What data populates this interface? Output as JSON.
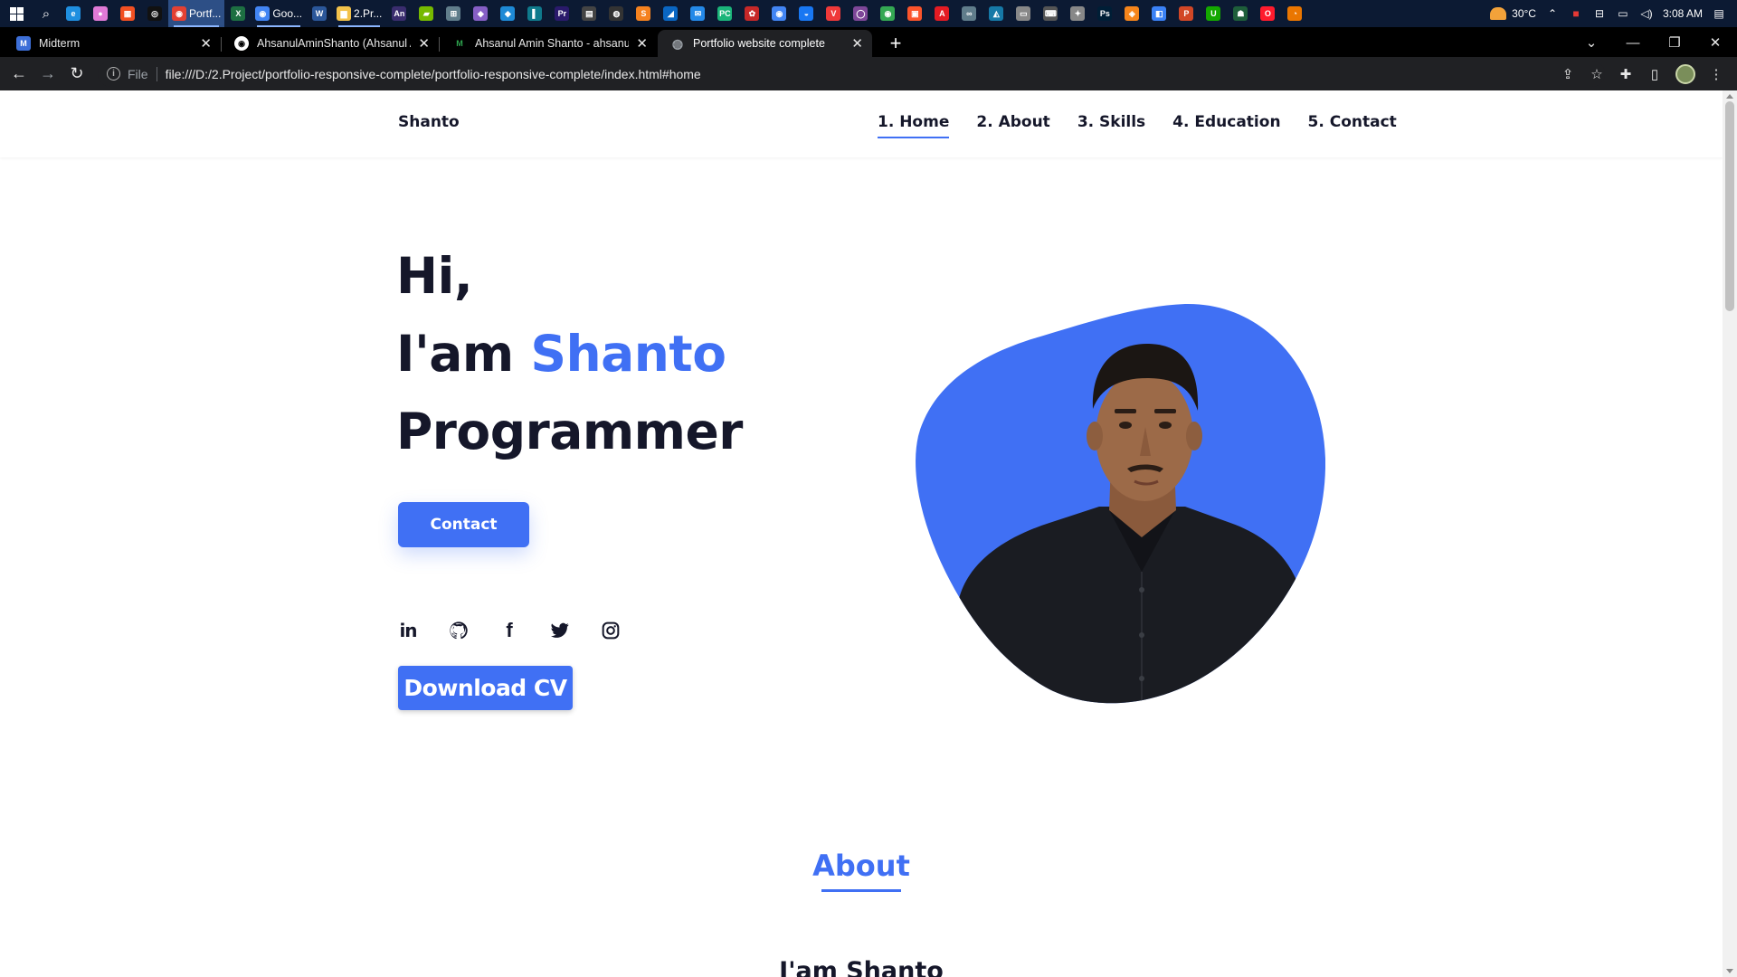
{
  "taskbar": {
    "apps": [
      {
        "name": "edge-icon",
        "color": "#1f8fe0",
        "glyph": "e"
      },
      {
        "name": "paint-icon",
        "color": "#e07ad6",
        "glyph": "●"
      },
      {
        "name": "store-icon",
        "color": "#f25022",
        "glyph": "▦"
      },
      {
        "name": "color-picker-icon",
        "color": "#111",
        "glyph": "◎"
      },
      {
        "name": "chrome-portfolio-icon",
        "label": "Portf...",
        "color": "#e34133",
        "glyph": "◉",
        "active": true
      },
      {
        "name": "excel-icon",
        "color": "#1d6f42",
        "glyph": "X"
      },
      {
        "name": "chrome-google-icon",
        "label": "Goo...",
        "color": "#4285f4",
        "glyph": "◉"
      },
      {
        "name": "word-icon",
        "color": "#2b579a",
        "glyph": "W"
      },
      {
        "name": "folder-icon",
        "label": "2.Pr...",
        "color": "#f3c24b",
        "glyph": "▆"
      },
      {
        "name": "animate-icon",
        "color": "#3a2d6e",
        "glyph": "An"
      },
      {
        "name": "nvidia-icon",
        "color": "#76b900",
        "glyph": "▰"
      },
      {
        "name": "vmware-icon",
        "color": "#607d8b",
        "glyph": "⊞"
      },
      {
        "name": "visual-studio-icon",
        "color": "#865fc5",
        "glyph": "◆"
      },
      {
        "name": "vscode-icon",
        "color": "#1e8ad6",
        "glyph": "◆"
      },
      {
        "name": "intellij-icon",
        "color": "#0f7a8c",
        "glyph": "▌"
      },
      {
        "name": "premiere-icon",
        "color": "#2a1a6b",
        "glyph": "Pr"
      },
      {
        "name": "terminal-icon",
        "color": "#444",
        "glyph": "▤"
      },
      {
        "name": "obs-icon",
        "color": "#333",
        "glyph": "◍"
      },
      {
        "name": "sublime-icon",
        "color": "#f5821f",
        "glyph": "S"
      },
      {
        "name": "figma-icon",
        "color": "#0a66c2",
        "glyph": "◢"
      },
      {
        "name": "mail-icon",
        "color": "#2489e8",
        "glyph": "✉"
      },
      {
        "name": "pycharm-icon",
        "color": "#1bb57a",
        "glyph": "PC"
      },
      {
        "name": "photos-icon",
        "color": "#c62828",
        "glyph": "✿"
      },
      {
        "name": "chrome-icon",
        "color": "#4285f4",
        "glyph": "◉"
      },
      {
        "name": "messenger-icon",
        "color": "#1877f2",
        "glyph": "◒"
      },
      {
        "name": "vivaldi-icon",
        "color": "#ef3939",
        "glyph": "V"
      },
      {
        "name": "tor-icon",
        "color": "#7e4798",
        "glyph": "◯"
      },
      {
        "name": "chrome-green-icon",
        "color": "#34a853",
        "glyph": "◉"
      },
      {
        "name": "brave-icon",
        "color": "#fb542b",
        "glyph": "▣"
      },
      {
        "name": "acrobat-icon",
        "color": "#e31b23",
        "glyph": "A"
      },
      {
        "name": "link-icon",
        "color": "#607d8b",
        "glyph": "∞"
      },
      {
        "name": "wireshark-icon",
        "color": "#1679a7",
        "glyph": "◭"
      },
      {
        "name": "monitor-icon",
        "color": "#888",
        "glyph": "▭"
      },
      {
        "name": "keyboard-icon",
        "color": "#555",
        "glyph": "⌨"
      },
      {
        "name": "bird-icon",
        "color": "#888",
        "glyph": "✦"
      },
      {
        "name": "photoshop-icon",
        "color": "#001e36",
        "glyph": "Ps"
      },
      {
        "name": "mask-icon",
        "color": "#f6851b",
        "glyph": "◈"
      },
      {
        "name": "cube-icon",
        "color": "#3b82f6",
        "glyph": "◧"
      },
      {
        "name": "powerpoint-icon",
        "color": "#d24726",
        "glyph": "P"
      },
      {
        "name": "upwork-icon",
        "color": "#14a800",
        "glyph": "U"
      },
      {
        "name": "ghost-icon",
        "color": "#1e5e3a",
        "glyph": "☗"
      },
      {
        "name": "opera-icon",
        "color": "#ff1b2d",
        "glyph": "O"
      },
      {
        "name": "blender-icon",
        "color": "#ea7600",
        "glyph": "◔"
      }
    ],
    "temperature": "30°C",
    "time": "3:08 AM"
  },
  "browser": {
    "tabs": [
      {
        "title": "Midterm",
        "favicon": "M",
        "favicon_color": "#3d6fd8"
      },
      {
        "title": "AhsanulAminShanto (Ahsanul Amin Shanto)",
        "favicon": "◉",
        "favicon_color": "#ffffff"
      },
      {
        "title": "Ahsanul Amin Shanto - ahsanulamin",
        "favicon": "M",
        "favicon_color": "#2ea44f"
      },
      {
        "title": "Portfolio website complete",
        "favicon": "◍",
        "favicon_color": "#9aa0a6",
        "active": true
      }
    ],
    "scheme": "File",
    "url": "file:///D:/2.Project/portfolio-responsive-complete/portfolio-responsive-complete/index.html#home"
  },
  "site": {
    "logo": "Shanto",
    "nav": [
      "1. Home",
      "2. About",
      "3. Skills",
      "4. Education",
      "5. Contact"
    ],
    "hero": {
      "greeting": "Hi,",
      "intro": "I'am",
      "name": "Shanto",
      "role": "Programmer"
    },
    "contact_button": "Contact",
    "socials": [
      "linkedin-icon",
      "github-icon",
      "facebook-icon",
      "twitter-icon",
      "instagram-icon"
    ],
    "download_cv": "Download CV",
    "about_title": "About",
    "about_subtitle": "I'am Shanto",
    "accent_color": "#4070f4",
    "text_color": "#15172a"
  }
}
